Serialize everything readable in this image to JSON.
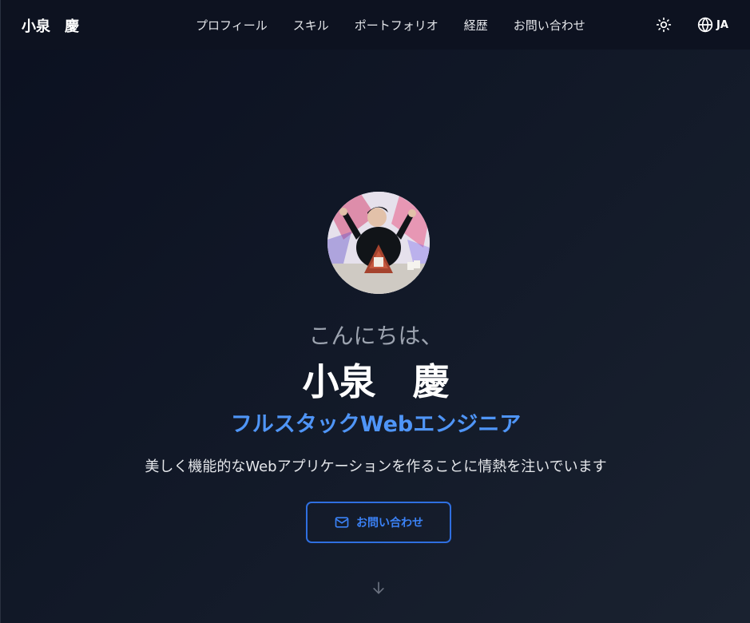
{
  "header": {
    "logo": "小泉　慶",
    "nav": [
      "プロフィール",
      "スキル",
      "ポートフォリオ",
      "経歴",
      "お問い合わせ"
    ],
    "theme_icon": "sun-icon",
    "language": "JA",
    "language_icon": "globe-icon"
  },
  "hero": {
    "greeting": "こんにちは、",
    "name": "小泉　慶",
    "role": "フルスタックWebエンジニア",
    "tagline": "美しく機能的なWebアプリケーションを作ることに情熱を注いでいます",
    "contact_button": "お問い合わせ",
    "contact_icon": "mail-icon",
    "scroll_icon": "arrow-down-icon"
  },
  "colors": {
    "background": "#111827",
    "accent": "#3b82f6",
    "role_text": "#4f95f7",
    "muted_text": "#9ca3af"
  }
}
